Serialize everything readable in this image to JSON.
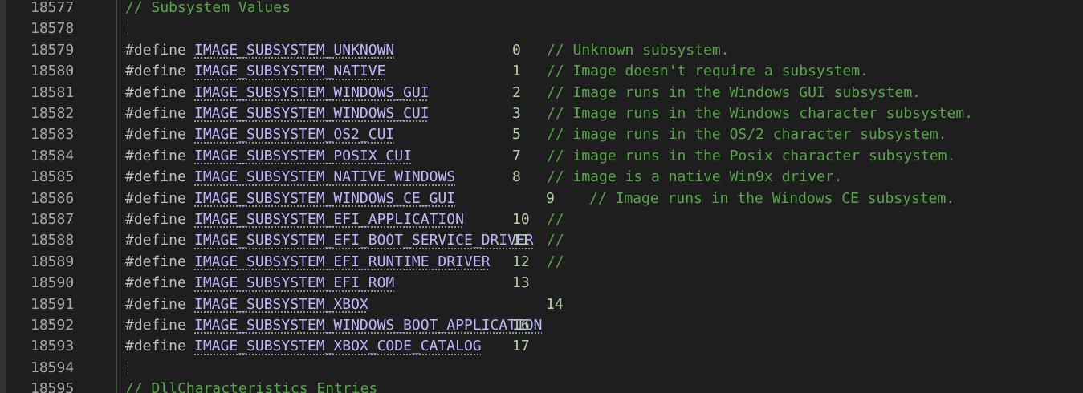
{
  "editor": {
    "lines": [
      {
        "num": "18577",
        "kind": "comment",
        "text": "// Subsystem Values"
      },
      {
        "num": "18578",
        "kind": "blank"
      },
      {
        "num": "18579",
        "kind": "define",
        "directive": "#define",
        "name": "IMAGE_SUBSYSTEM_UNKNOWN",
        "value": "0",
        "comment": "// Unknown subsystem."
      },
      {
        "num": "18580",
        "kind": "define",
        "directive": "#define",
        "name": "IMAGE_SUBSYSTEM_NATIVE",
        "value": "1",
        "comment": "// Image doesn't require a subsystem."
      },
      {
        "num": "18581",
        "kind": "define",
        "directive": "#define",
        "name": "IMAGE_SUBSYSTEM_WINDOWS_GUI",
        "value": "2",
        "comment": "// Image runs in the Windows GUI subsystem."
      },
      {
        "num": "18582",
        "kind": "define",
        "directive": "#define",
        "name": "IMAGE_SUBSYSTEM_WINDOWS_CUI",
        "value": "3",
        "comment": "// Image runs in the Windows character subsystem."
      },
      {
        "num": "18583",
        "kind": "define",
        "directive": "#define",
        "name": "IMAGE_SUBSYSTEM_OS2_CUI",
        "value": "5",
        "comment": "// image runs in the OS/2 character subsystem."
      },
      {
        "num": "18584",
        "kind": "define",
        "directive": "#define",
        "name": "IMAGE_SUBSYSTEM_POSIX_CUI",
        "value": "7",
        "comment": "// image runs in the Posix character subsystem."
      },
      {
        "num": "18585",
        "kind": "define",
        "directive": "#define",
        "name": "IMAGE_SUBSYSTEM_NATIVE_WINDOWS",
        "value": "8",
        "comment": "// image is a native Win9x driver."
      },
      {
        "num": "18586",
        "kind": "define",
        "directive": "#define",
        "name": "IMAGE_SUBSYSTEM_WINDOWS_CE_GUI",
        "value": "9",
        "comment": "// Image runs in the Windows CE subsystem."
      },
      {
        "num": "18587",
        "kind": "define",
        "directive": "#define",
        "name": "IMAGE_SUBSYSTEM_EFI_APPLICATION",
        "value": "10",
        "comment": "//"
      },
      {
        "num": "18588",
        "kind": "define",
        "directive": "#define",
        "name": "IMAGE_SUBSYSTEM_EFI_BOOT_SERVICE_DRIVER",
        "value": "11",
        "comment": "//"
      },
      {
        "num": "18589",
        "kind": "define",
        "directive": "#define",
        "name": "IMAGE_SUBSYSTEM_EFI_RUNTIME_DRIVER",
        "value": "12",
        "comment": "//"
      },
      {
        "num": "18590",
        "kind": "define",
        "directive": "#define",
        "name": "IMAGE_SUBSYSTEM_EFI_ROM",
        "value": "13",
        "comment": ""
      },
      {
        "num": "18591",
        "kind": "define",
        "directive": "#define",
        "name": "IMAGE_SUBSYSTEM_XBOX",
        "value": "14",
        "comment": ""
      },
      {
        "num": "18592",
        "kind": "define",
        "directive": "#define",
        "name": "IMAGE_SUBSYSTEM_WINDOWS_BOOT_APPLICATION",
        "value": "16",
        "comment": ""
      },
      {
        "num": "18593",
        "kind": "define",
        "directive": "#define",
        "name": "IMAGE_SUBSYSTEM_XBOX_CODE_CATALOG",
        "value": "17",
        "comment": ""
      },
      {
        "num": "18594",
        "kind": "blank"
      },
      {
        "num": "18595",
        "kind": "comment",
        "text": "// DllCharacteristics Entries"
      }
    ]
  },
  "colors": {
    "background": "#1e1e1e",
    "line_number": "#a8a8a8",
    "comment": "#57a64a",
    "directive": "#c0c0c0",
    "macro_name": "#beb7ff",
    "number": "#b5cea8"
  }
}
